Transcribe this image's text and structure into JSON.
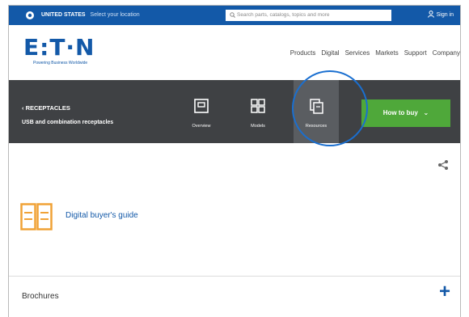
{
  "topbar": {
    "country": "UNITED STATES",
    "select_location": "Select your location",
    "search_placeholder": "Search parts, catalogs, topics and more",
    "signin": "Sign in"
  },
  "header": {
    "logo": "E:T·N",
    "tagline": "Powering Business Worldwide",
    "nav": [
      "Products",
      "Digital",
      "Services",
      "Markets",
      "Support",
      "Company"
    ]
  },
  "productbar": {
    "breadcrumb": "‹ RECEPTACLES",
    "product": "USB and combination receptacles",
    "tabs": [
      {
        "label": "Overview",
        "icon": "overview-icon"
      },
      {
        "label": "Models",
        "icon": "models-grid-icon"
      },
      {
        "label": "Resources",
        "icon": "resources-icon"
      }
    ],
    "active_tab": "Resources",
    "how_to_buy": "How to buy"
  },
  "content": {
    "guide_title": "Digital buyer's guide",
    "brochures": "Brochures"
  },
  "colors": {
    "brand_blue": "#1359a8",
    "dark_bar": "#3f4144",
    "green": "#4fa83a",
    "guide_orange": "#f0a236",
    "highlight": "#1a6fd0"
  }
}
